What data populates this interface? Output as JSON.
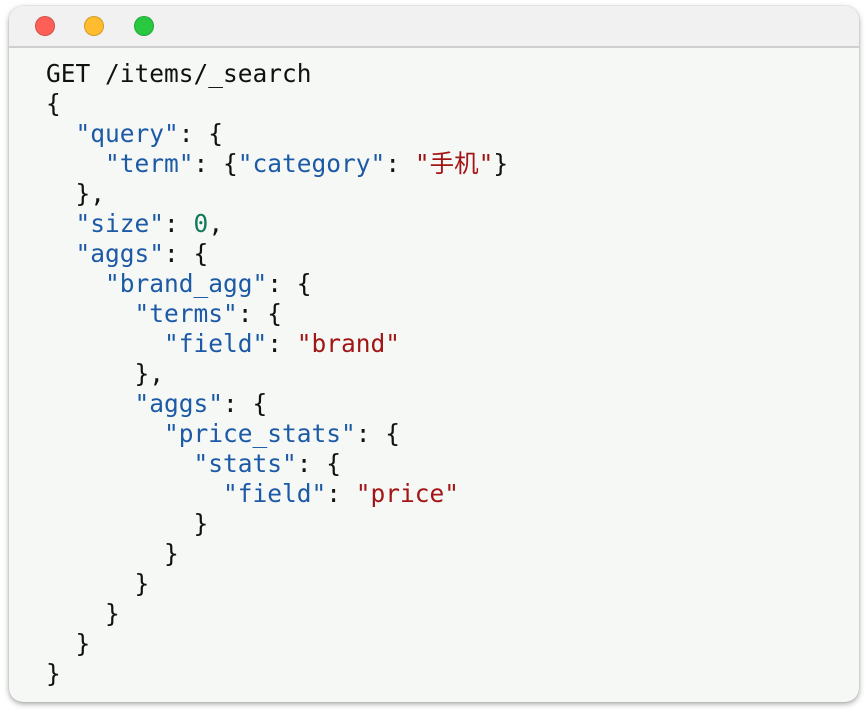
{
  "window": {
    "traffic_lights": {
      "close": "#fe5f57",
      "minimize": "#febc2e",
      "zoom": "#28c840"
    }
  },
  "colors": {
    "key": "#1c5aa6",
    "string": "#a31515",
    "number": "#117a5a",
    "punct": "#111111",
    "background": "#f6f8f6"
  },
  "code": {
    "request_line": "GET /items/_search",
    "lines": [
      [
        [
          "p",
          "{"
        ]
      ],
      [
        [
          "p",
          "  "
        ],
        [
          "k",
          "\"query\""
        ],
        [
          "p",
          ": {"
        ]
      ],
      [
        [
          "p",
          "    "
        ],
        [
          "k",
          "\"term\""
        ],
        [
          "p",
          ": {"
        ],
        [
          "k",
          "\"category\""
        ],
        [
          "p",
          ": "
        ],
        [
          "s",
          "\"手机\""
        ],
        [
          "p",
          "}"
        ]
      ],
      [
        [
          "p",
          "  },"
        ]
      ],
      [
        [
          "p",
          "  "
        ],
        [
          "k",
          "\"size\""
        ],
        [
          "p",
          ": "
        ],
        [
          "n",
          "0"
        ],
        [
          "p",
          ","
        ]
      ],
      [
        [
          "p",
          "  "
        ],
        [
          "k",
          "\"aggs\""
        ],
        [
          "p",
          ": {"
        ]
      ],
      [
        [
          "p",
          "    "
        ],
        [
          "k",
          "\"brand_agg\""
        ],
        [
          "p",
          ": {"
        ]
      ],
      [
        [
          "p",
          "      "
        ],
        [
          "k",
          "\"terms\""
        ],
        [
          "p",
          ": {"
        ]
      ],
      [
        [
          "p",
          "        "
        ],
        [
          "k",
          "\"field\""
        ],
        [
          "p",
          ": "
        ],
        [
          "s",
          "\"brand\""
        ]
      ],
      [
        [
          "p",
          "      },"
        ]
      ],
      [
        [
          "p",
          "      "
        ],
        [
          "k",
          "\"aggs\""
        ],
        [
          "p",
          ": {"
        ]
      ],
      [
        [
          "p",
          "        "
        ],
        [
          "k",
          "\"price_stats\""
        ],
        [
          "p",
          ": {"
        ]
      ],
      [
        [
          "p",
          "          "
        ],
        [
          "k",
          "\"stats\""
        ],
        [
          "p",
          ": {"
        ]
      ],
      [
        [
          "p",
          "            "
        ],
        [
          "k",
          "\"field\""
        ],
        [
          "p",
          ": "
        ],
        [
          "s",
          "\"price\""
        ]
      ],
      [
        [
          "p",
          "          }"
        ]
      ],
      [
        [
          "p",
          "        }"
        ]
      ],
      [
        [
          "p",
          "      }"
        ]
      ],
      [
        [
          "p",
          "    }"
        ]
      ],
      [
        [
          "p",
          "  }"
        ]
      ],
      [
        [
          "p",
          "}"
        ]
      ]
    ]
  }
}
